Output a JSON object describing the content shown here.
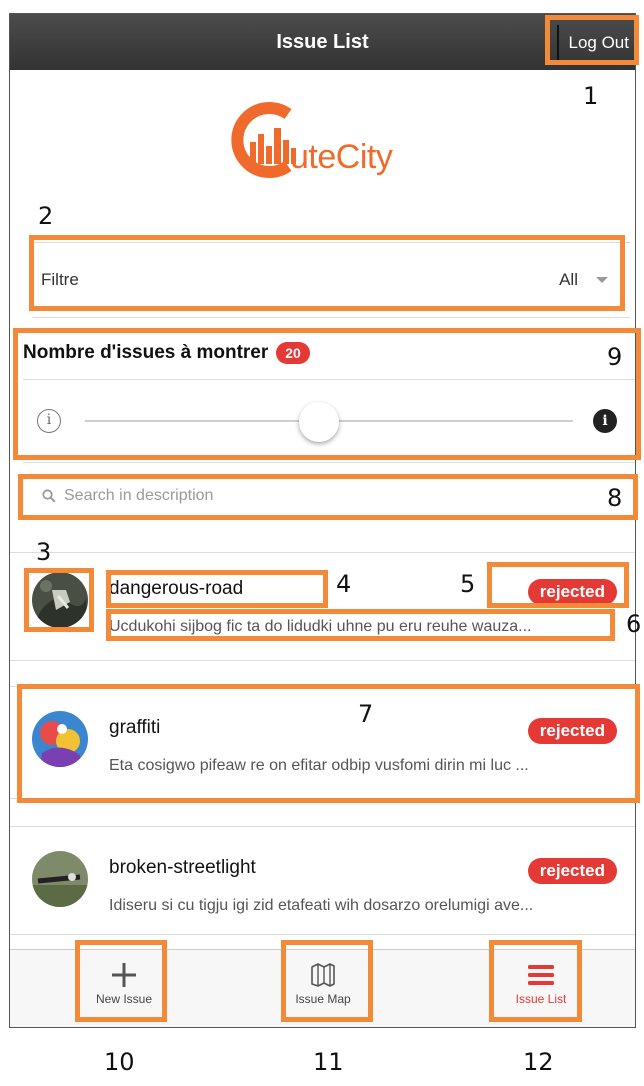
{
  "header": {
    "title": "Issue List",
    "logout_label": "Log Out"
  },
  "logo": {
    "text": "uteCity",
    "brand_letter": "C",
    "brand_color": "#ef6a2b"
  },
  "filter": {
    "label": "Filtre",
    "value": "All"
  },
  "range": {
    "title": "Nombre d'issues à montrer",
    "count": "20",
    "min_icon": "info-outline-icon",
    "max_icon": "info-filled-icon",
    "level_fraction": 0.48
  },
  "search": {
    "placeholder": "Search in description"
  },
  "issues": [
    {
      "title": "dangerous-road",
      "state": "rejected",
      "description": "Ucdukohi sijbog fic ta do lidudki uhne pu eru reuhe wauza..."
    },
    {
      "title": "graffiti",
      "state": "rejected",
      "description": "Eta cosigwo pifeaw re on efitar odbip vusfomi dirin mi luc ..."
    },
    {
      "title": "broken-streetlight",
      "state": "rejected",
      "description": "Idiseru si cu tigju igi zid etafeati wih dosarzo orelumigi ave..."
    }
  ],
  "tabs": [
    {
      "label": "New Issue",
      "icon": "plus-icon"
    },
    {
      "label": "Issue Map",
      "icon": "map-icon"
    },
    {
      "label": "Issue List",
      "icon": "list-icon",
      "active": true
    }
  ],
  "annotations": [
    "1",
    "2",
    "3",
    "4",
    "5",
    "6",
    "7",
    "8",
    "9",
    "10",
    "11",
    "12"
  ],
  "colors": {
    "accent_red": "#e53935",
    "annotation_orange": "#f28a3a",
    "header_bg": "#3f3f3f"
  }
}
